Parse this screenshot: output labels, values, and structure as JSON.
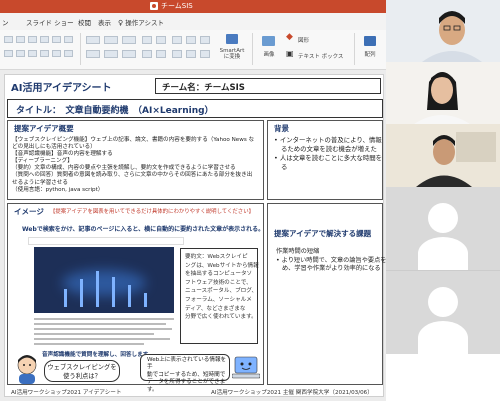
{
  "app": {
    "window_title": "チームSIS"
  },
  "ribbon": {
    "tabs": [
      "ン",
      "スライド ショー",
      "校閲",
      "表示",
      "操作アシスト"
    ],
    "smartart_label": "SmartArt\nに変換",
    "image_label": "画像",
    "shape_label": "図形",
    "textbox_label": "テキスト ボックス",
    "arrange_label": "配列"
  },
  "slide": {
    "title": "AI活用アイデアシート",
    "team": "チーム名：チームSIS",
    "theme": "タイトル：　文章自動要約機　（AI×Learning）",
    "proposal": {
      "heading": "提案アイデア概要",
      "lines": [
        "【ウェブスクレイピング機能】ウェブ上の記事、論文、書籍の内容を要約する（Yahoo News な",
        "どの見出しにも活用されている）",
        "【音声認識機能】音声の内容を理解する",
        "【ディープラーニング】",
        "（要約）文章の構成、内容の要点や主張を読解し、要約文を作成できるように学習させる",
        "（質問への回答）質問者の意図を読み取り、さらに文章の中からその回答にあたる部分を抜き出",
        "せるように学習させる",
        "（使用言語：python, java script）"
      ]
    },
    "image": {
      "heading": "イメージ",
      "note": "【提案アイデアを図表を用いてできるだけ具体的にわかりやすく説明してください】",
      "caption": "Webで検索をかけ、記事のページに入ると、横に自動的に要約された文章が表示される。",
      "summary_lines": [
        "要約文：Webスクレイピ",
        "ングは、Webサイトから情報",
        "を抽出するコンピュータソ",
        "フトウェア技術のことで、",
        "ニュースポータル、ブログ、",
        "フォーラム、ソーシャルメ",
        "ディア、などさまざまな",
        "分野で広く使われています。"
      ],
      "voice_text": "音声認識機能で質問を理解し、回答します",
      "question_bubble": "ウェブスクレイピングを\n使う利点は？",
      "answer_bubble": [
        "Web上に表示されている情報を手",
        "動でコピーするため、短時間で",
        "データを所得することができます。"
      ]
    },
    "background": {
      "heading": "背景",
      "bullets": [
        "インターネットの普及により、情報",
        "るための文章を読む機会が増えた",
        "人は文章を読むことに多大な時間を",
        "る"
      ]
    },
    "solution": {
      "heading": "提案アイデアで解決する課題",
      "lines": [
        "作業時間の短縮",
        "より短い時間で、文章の論旨や要点を理解",
        "め、学習や作業がより効率的になる"
      ]
    },
    "footer_left": "AI活用ワークショップ2021 アイデアシート",
    "footer_right": "AI活用ワークショップ2021 主催 関西学院大学（2021/03/06）"
  },
  "colors": {
    "ppt_accent": "#c8492c",
    "heading_blue": "#1f3a6e",
    "note_red": "#c0392b"
  }
}
